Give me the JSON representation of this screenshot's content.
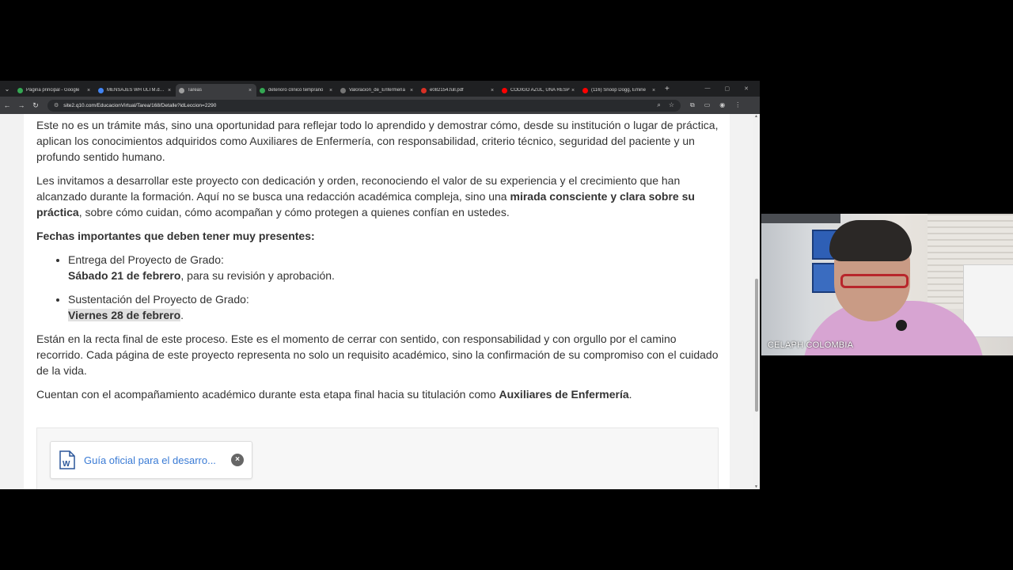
{
  "browser": {
    "tabs": [
      {
        "title": "Página principal - Google",
        "color": "#34a853",
        "active": false
      },
      {
        "title": "MENSAJES WH ULTM.docx",
        "color": "#4285f4",
        "active": false
      },
      {
        "title": "Tareas",
        "color": "#9e9e9e",
        "active": true
      },
      {
        "title": "deterioro clínico temprano",
        "color": "#34a853",
        "active": false
      },
      {
        "title": "Valoracion_de_Enfermería",
        "color": "#757575",
        "active": false
      },
      {
        "title": "e082154.full.pdf",
        "color": "#d93025",
        "active": false
      },
      {
        "title": "CODIGO AZUL, UNA RESP",
        "color": "#ff0000",
        "active": false
      },
      {
        "title": "(116) Snoop Dogg, Emine",
        "color": "#ff0000",
        "active": false
      }
    ],
    "new_tab": "+",
    "url": "site2.q10.com/EducacionVirtual/Tarea/168/Detalle?idLeccion=2290"
  },
  "content": {
    "p1": "Este no es un trámite más, sino una oportunidad para reflejar todo lo aprendido y demostrar cómo, desde su institución o lugar de práctica, aplican los conocimientos adquiridos como Auxiliares de Enfermería, con responsabilidad, criterio técnico, seguridad del paciente y un profundo sentido humano.",
    "p2_a": "Les invitamos a desarrollar este proyecto con dedicación y orden, reconociendo el valor de su experiencia y el crecimiento que han alcanzado durante la formación. Aquí no se busca una redacción académica compleja, sino una ",
    "p2_b": "mirada consciente y clara sobre su práctica",
    "p2_c": ", sobre cómo cuidan, cómo acompañan y cómo protegen a quienes confían en ustedes.",
    "dates_heading": "Fechas importantes que deben tener muy presentes:",
    "item1_title": "Entrega del Proyecto de Grado:",
    "item1_date": "Sábado 21 de febrero",
    "item1_rest": ", para su revisión y aprobación.",
    "item2_title": "Sustentación del Proyecto de Grado:",
    "item2_date": "Viernes 28 de febrero",
    "item2_rest": ".",
    "p3": "Están en la recta final de este proceso. Este es el momento de cerrar con sentido, con responsabilidad y con orgullo por el camino recorrido. Cada página de este proyecto representa no solo un requisito académico, sino la confirmación de su compromiso con el cuidado de la vida.",
    "p4_a": "Cuentan con el acompañamiento académico durante esta etapa final hacia su titulación como ",
    "p4_b": "Auxiliares de Enfermería",
    "p4_c": "."
  },
  "attachment": {
    "name": "Guía oficial para el desarro...",
    "remove": "×"
  },
  "webcam": {
    "participant_name": "CELAPH COLOMBIA"
  }
}
